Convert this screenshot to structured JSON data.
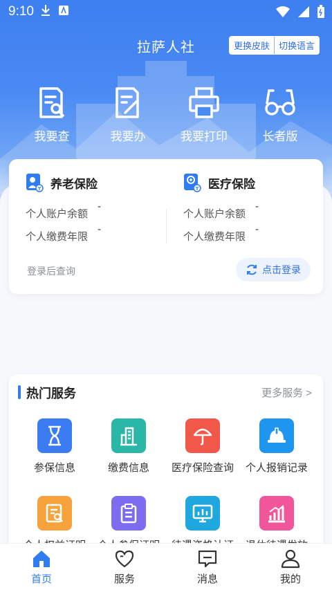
{
  "status": {
    "time": "9:10"
  },
  "header": {
    "title": "拉萨人社",
    "skin_label": "更换皮肤",
    "lang_label": "切换语言"
  },
  "quick_actions": [
    {
      "label": "我要查",
      "icon": "doc-search-icon"
    },
    {
      "label": "我要办",
      "icon": "doc-edit-icon"
    },
    {
      "label": "我要打印",
      "icon": "printer-icon"
    },
    {
      "label": "长者版",
      "icon": "glasses-icon"
    }
  ],
  "insurance": {
    "pension": {
      "title": "养老保险",
      "balance_label": "个人账户余额",
      "balance_value": "-",
      "years_label": "个人缴费年限",
      "years_value": "-"
    },
    "medical": {
      "title": "医疗保险",
      "balance_label": "个人账户余额",
      "balance_value": "-",
      "years_label": "个人缴费年限",
      "years_value": "-"
    },
    "hint": "登录后查询",
    "login_label": "点击登录"
  },
  "services": {
    "title": "热门服务",
    "more_label": "更多服务 >",
    "items": [
      {
        "label": "参保信息",
        "icon": "hourglass-icon",
        "color": "#3b7cf3"
      },
      {
        "label": "缴费信息",
        "icon": "building-icon",
        "color": "#2bb7a8"
      },
      {
        "label": "医疗保险查询",
        "icon": "umbrella-icon",
        "color": "#f1584a"
      },
      {
        "label": "个人报销记录",
        "icon": "helmet-icon",
        "color": "#1e96f0"
      },
      {
        "label": "个人权益证明",
        "icon": "doc-search-icon",
        "color": "#f7a23b"
      },
      {
        "label": "个人参保证明",
        "icon": "clipboard-icon",
        "color": "#7b6cf0"
      },
      {
        "label": "待遇资格认证",
        "icon": "monitor-chart-icon",
        "color": "#1fa8e0"
      },
      {
        "label": "退休待遇发放",
        "icon": "bar-chart-icon",
        "color": "#f2569a"
      }
    ]
  },
  "tabs": [
    {
      "label": "首页",
      "icon": "home-icon"
    },
    {
      "label": "服务",
      "icon": "heart-icon"
    },
    {
      "label": "消息",
      "icon": "message-icon"
    },
    {
      "label": "我的",
      "icon": "user-icon"
    }
  ]
}
